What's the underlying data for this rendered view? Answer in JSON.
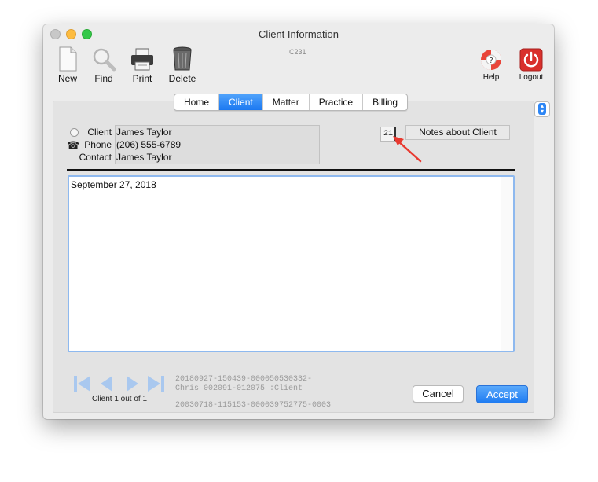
{
  "window": {
    "title": "Client Information",
    "code": "C231"
  },
  "toolbar": {
    "new_label": "New",
    "find_label": "Find",
    "print_label": "Print",
    "delete_label": "Delete",
    "help_label": "Help",
    "logout_label": "Logout"
  },
  "tabs": [
    {
      "label": "Home"
    },
    {
      "label": "Client"
    },
    {
      "label": "Matter"
    },
    {
      "label": "Practice"
    },
    {
      "label": "Billing"
    }
  ],
  "active_tab": "Client",
  "client": {
    "client_label": "Client",
    "client_value": "James Taylor",
    "phone_label": "Phone",
    "phone_value": "(206) 555-6789",
    "contact_label": "Contact",
    "contact_value": "James Taylor"
  },
  "notes": {
    "count": "21",
    "button_label": "Notes about Client",
    "text": "September 27, 2018"
  },
  "navigation": {
    "status": "Client 1 out of 1"
  },
  "meta": {
    "line1": "20180927-150439-000050530332-",
    "line2": "Chris 002091-012075 :Client",
    "line3": "20030718-115153-000039752775-0003"
  },
  "actions": {
    "cancel_label": "Cancel",
    "accept_label": "Accept"
  },
  "colors": {
    "accent": "#1b78f1",
    "annotation_arrow": "#e8392f",
    "logout_red": "#d9302c"
  }
}
